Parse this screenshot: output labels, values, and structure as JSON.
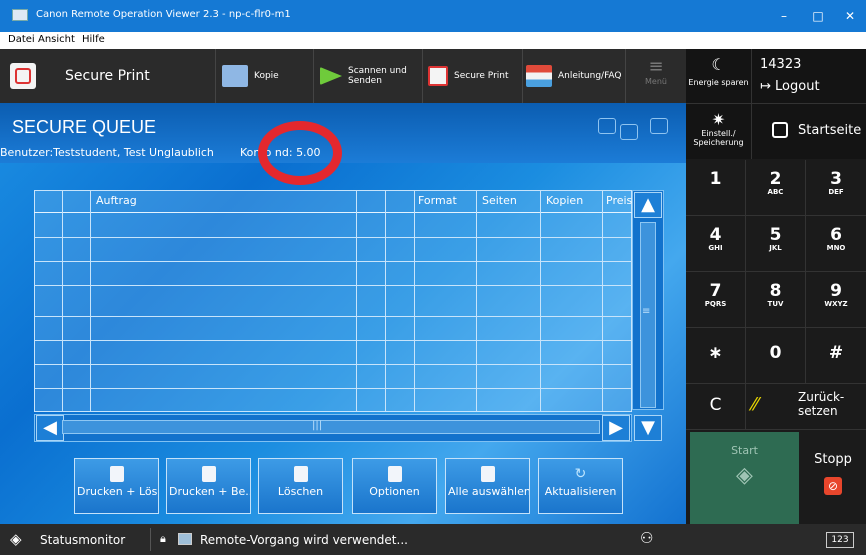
{
  "window": {
    "title": "Canon Remote Operation Viewer 2.3 - np-c-flr0-m1",
    "minimize": "–",
    "maximize": "□",
    "close": "✕"
  },
  "menu": [
    "Datei",
    "Ansicht",
    "Hilfe"
  ],
  "appbar": {
    "app_title": "Secure Print",
    "nav": [
      "Kopie",
      "Scannen und\nSenden",
      "Secure Print",
      "Anleitung/FAQ"
    ],
    "menu_label": "Menü"
  },
  "right": {
    "energy": "Energie sparen",
    "user_id": "14323",
    "logout": "Logout",
    "settings": "Einstell./\nSpeicherung",
    "home": "Startseite",
    "keys": [
      {
        "n": "1",
        "s": ""
      },
      {
        "n": "2",
        "s": "ABC"
      },
      {
        "n": "3",
        "s": "DEF"
      },
      {
        "n": "4",
        "s": "GHI"
      },
      {
        "n": "5",
        "s": "JKL"
      },
      {
        "n": "6",
        "s": "MNO"
      },
      {
        "n": "7",
        "s": "PQRS"
      },
      {
        "n": "8",
        "s": "TUV"
      },
      {
        "n": "9",
        "s": "WXYZ"
      },
      {
        "n": "∗",
        "s": ""
      },
      {
        "n": "0",
        "s": ""
      },
      {
        "n": "#",
        "s": ""
      }
    ],
    "clear": "C",
    "reset": "Zurück-\nsetzen",
    "start": "Start",
    "stop": "Stopp"
  },
  "queue": {
    "title": "SECURE QUEUE",
    "user": "Benutzer:Teststudent, Test Unglaublich",
    "konto": "Konto     nd: 5.00",
    "columns": [
      "Auftrag",
      "Format",
      "Seiten",
      "Kopien",
      "Preis"
    ]
  },
  "actions": [
    "Drucken + Lös...",
    "Drucken + Be...",
    "Löschen",
    "Optionen",
    "Alle auswählen",
    "Aktualisieren"
  ],
  "status": {
    "monitor": "Statusmonitor",
    "message": "Remote-Vorgang wird verwendet...",
    "kbd": "123"
  },
  "colors": {
    "accent": "#1579d4",
    "start_bg": "#2e6b52",
    "stop_icon": "#e8462c",
    "reset_icon": "#e8d600",
    "mark": "#e4282e"
  }
}
